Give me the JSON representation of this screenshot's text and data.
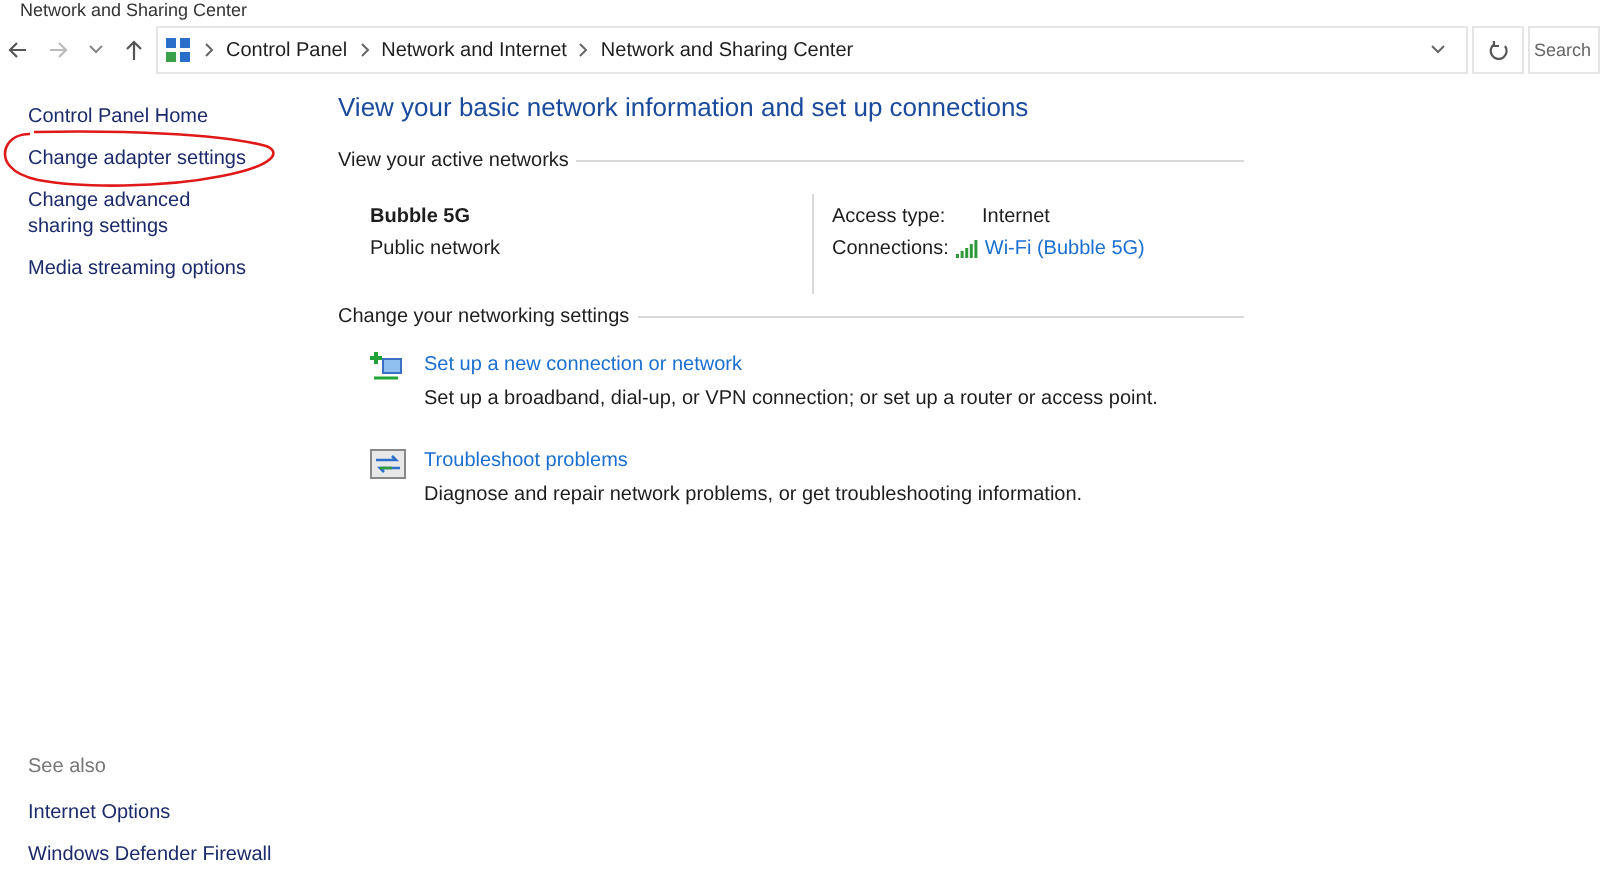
{
  "window": {
    "title": "Network and Sharing Center"
  },
  "address_bar": {
    "breadcrumbs": [
      "Control Panel",
      "Network and Internet",
      "Network and Sharing Center"
    ],
    "search_placeholder": "Search"
  },
  "sidebar": {
    "items": [
      {
        "label": "Control Panel Home",
        "highlighted": false
      },
      {
        "label": "Change adapter settings",
        "highlighted": true
      },
      {
        "label": "Change advanced sharing settings",
        "highlighted": false
      },
      {
        "label": "Media streaming options",
        "highlighted": false
      }
    ],
    "see_also": {
      "heading": "See also",
      "items": [
        "Internet Options",
        "Windows Defender Firewall"
      ]
    }
  },
  "main": {
    "heading": "View your basic network information and set up connections",
    "active_networks": {
      "heading": "View your active networks",
      "name": "Bubble 5G",
      "category": "Public network",
      "access_label": "Access type:",
      "access_value": "Internet",
      "connections_label": "Connections:",
      "connection_link": "Wi-Fi (Bubble 5G)"
    },
    "settings": {
      "heading": "Change your networking settings",
      "tasks": [
        {
          "kind": "new-connection",
          "title": "Set up a new connection or network",
          "description": "Set up a broadband, dial-up, or VPN connection; or set up a router or access point."
        },
        {
          "kind": "troubleshoot",
          "title": "Troubleshoot problems",
          "description": "Diagnose and repair network problems, or get troubleshooting information."
        }
      ]
    }
  }
}
